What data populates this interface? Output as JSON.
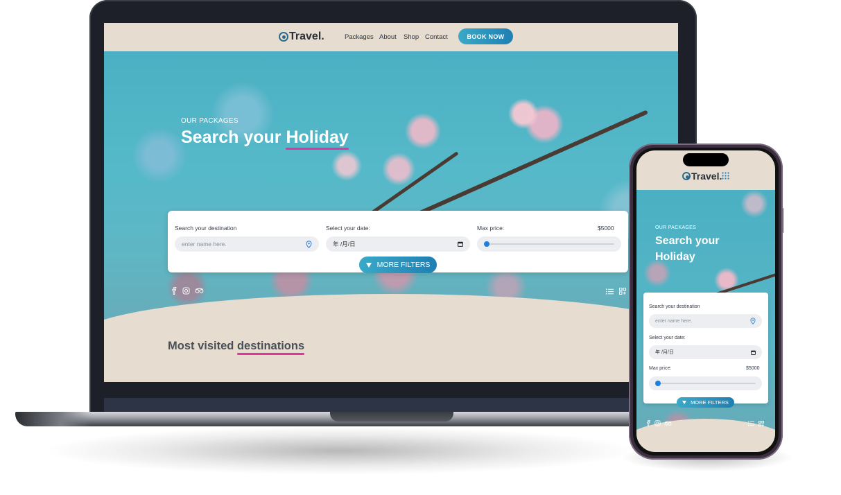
{
  "brand": {
    "name": "Travel.",
    "accent_color": "#e0359c",
    "button_gradient": [
      "#3aa9c7",
      "#1f7fb3"
    ],
    "background": "#e6ddd0"
  },
  "nav": {
    "links": [
      "Packages",
      "About",
      "Shop",
      "Contact"
    ],
    "cta": "BOOK NOW"
  },
  "hero": {
    "eyebrow": "OUR PACKAGES",
    "title_prefix": "Search your",
    "title_highlight": "Holiday"
  },
  "search": {
    "destination_label": "Search your destination",
    "destination_placeholder": "enter name here.",
    "date_label": "Select your date:",
    "date_value": "年 /月/日",
    "price_label": "Max price:",
    "price_value": "$5000",
    "price_slider_fraction": 0.0,
    "more_filters": "MORE FILTERS"
  },
  "social_icons": [
    "facebook-icon",
    "instagram-icon",
    "tripadvisor-icon"
  ],
  "view_icons": [
    "list-view-icon",
    "grid-view-icon"
  ],
  "section": {
    "title_prefix": "Most visited",
    "title_highlight": "destinations"
  },
  "icons": {
    "location": "pin-icon",
    "calendar": "calendar-icon",
    "filter": "filter-icon",
    "mobile_menu": "menu-grid-icon"
  }
}
